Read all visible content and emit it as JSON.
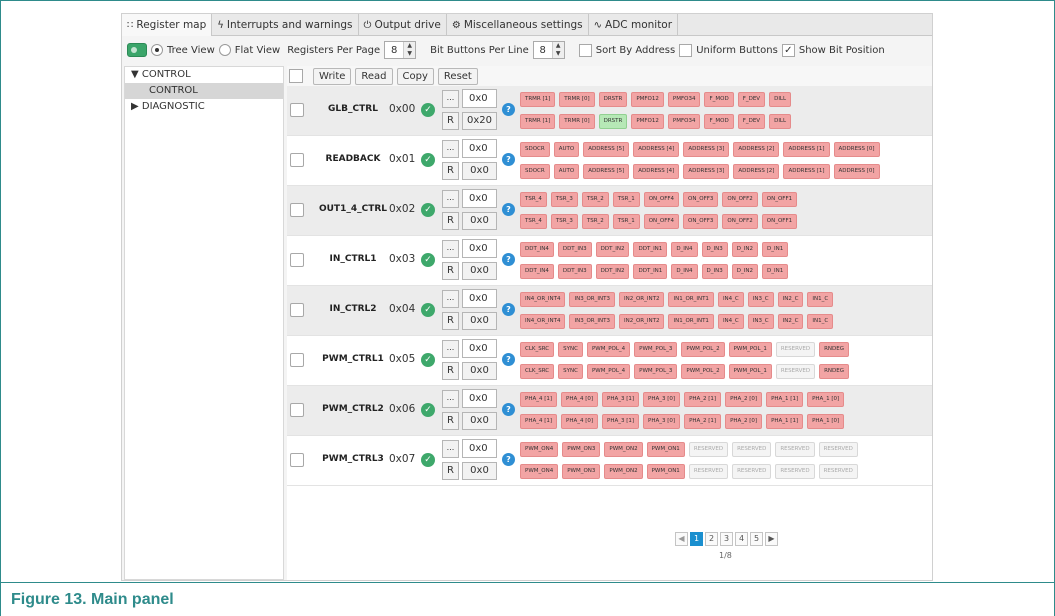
{
  "tabs": [
    {
      "label": "Register map",
      "icon": "grid-icon",
      "glyph": "∷"
    },
    {
      "label": "Interrupts and warnings",
      "icon": "lightning-icon",
      "glyph": "ϟ"
    },
    {
      "label": "Output drive",
      "icon": "power-icon",
      "glyph": "⏻"
    },
    {
      "label": "Miscellaneous settings",
      "icon": "gear-icon",
      "glyph": "⚙"
    },
    {
      "label": "ADC monitor",
      "icon": "oscilloscope-icon",
      "glyph": "∿"
    }
  ],
  "toolbar": {
    "tree_view": "Tree View",
    "flat_view": "Flat View",
    "registers_per_page_label": "Registers Per Page",
    "registers_per_page_value": "8",
    "bit_buttons_label": "Bit Buttons Per Line",
    "bit_buttons_value": "8",
    "sort_by_address": "Sort By Address",
    "uniform_buttons": "Uniform Buttons",
    "show_bit_position": "Show Bit Position"
  },
  "tree": {
    "items": [
      "▼ CONTROL",
      "CONTROL",
      "▶ DIAGNOSTIC"
    ]
  },
  "actions": {
    "write": "Write",
    "read": "Read",
    "copy": "Copy",
    "reset": "Reset"
  },
  "row_controls": {
    "dots": "...",
    "read": "R"
  },
  "registers": [
    {
      "name": "GLB_CTRL",
      "addr": "0x00",
      "write_value": "0x0",
      "read_value": "0x20",
      "bits_write": [
        "TRMR [1]",
        "TRMR [0]",
        "DRSTR",
        "PMFO12",
        "PMFO34",
        "F_MOD",
        "F_DEV",
        "DILL"
      ],
      "bits_read": [
        "TRMR [1]",
        "TRMR [0]",
        "DRSTR",
        "PMFO12",
        "PMFO34",
        "F_MOD",
        "F_DEV",
        "DILL"
      ]
    },
    {
      "name": "READBACK",
      "addr": "0x01",
      "write_value": "0x0",
      "read_value": "0x0",
      "bits_write": [
        "SDOCR",
        "AUTO",
        "ADDRESS [5]",
        "ADDRESS [4]",
        "ADDRESS [3]",
        "ADDRESS [2]",
        "ADDRESS [1]",
        "ADDRESS [0]"
      ],
      "bits_read": [
        "SDOCR",
        "AUTO",
        "ADDRESS [5]",
        "ADDRESS [4]",
        "ADDRESS [3]",
        "ADDRESS [2]",
        "ADDRESS [1]",
        "ADDRESS [0]"
      ]
    },
    {
      "name": "OUT1_4_CTRL",
      "addr": "0x02",
      "write_value": "0x0",
      "read_value": "0x0",
      "bits_write": [
        "TSR_4",
        "TSR_3",
        "TSR_2",
        "TSR_1",
        "ON_OFF4",
        "ON_OFF3",
        "ON_OFF2",
        "ON_OFF1"
      ],
      "bits_read": [
        "TSR_4",
        "TSR_3",
        "TSR_2",
        "TSR_1",
        "ON_OFF4",
        "ON_OFF3",
        "ON_OFF2",
        "ON_OFF1"
      ]
    },
    {
      "name": "IN_CTRL1",
      "addr": "0x03",
      "write_value": "0x0",
      "read_value": "0x0",
      "bits_write": [
        "DDT_IN4",
        "DDT_IN3",
        "DDT_IN2",
        "DDT_IN1",
        "D_IN4",
        "D_IN3",
        "D_IN2",
        "D_IN1"
      ],
      "bits_read": [
        "DDT_IN4",
        "DDT_IN3",
        "DDT_IN2",
        "DDT_IN1",
        "D_IN4",
        "D_IN3",
        "D_IN2",
        "D_IN1"
      ]
    },
    {
      "name": "IN_CTRL2",
      "addr": "0x04",
      "write_value": "0x0",
      "read_value": "0x0",
      "bits_write": [
        "IN4_OR_INT4",
        "IN3_OR_INT3",
        "IN2_OR_INT2",
        "IN1_OR_INT1",
        "IN4_C",
        "IN3_C",
        "IN2_C",
        "IN1_C"
      ],
      "bits_read": [
        "IN4_OR_INT4",
        "IN3_OR_INT3",
        "IN2_OR_INT2",
        "IN1_OR_INT1",
        "IN4_C",
        "IN3_C",
        "IN2_C",
        "IN1_C"
      ]
    },
    {
      "name": "PWM_CTRL1",
      "addr": "0x05",
      "write_value": "0x0",
      "read_value": "0x0",
      "bits_write": [
        "CLK_SRC",
        "SYNC",
        "PWM_POL_4",
        "PWM_POL_3",
        "PWM_POL_2",
        "PWM_POL_1",
        "RESERVED",
        "RNDEG"
      ],
      "bits_read": [
        "CLK_SRC",
        "SYNC",
        "PWM_POL_4",
        "PWM_POL_3",
        "PWM_POL_2",
        "PWM_POL_1",
        "RESERVED",
        "RNDEG"
      ]
    },
    {
      "name": "PWM_CTRL2",
      "addr": "0x06",
      "write_value": "0x0",
      "read_value": "0x0",
      "bits_write": [
        "PHA_4 [1]",
        "PHA_4 [0]",
        "PHA_3 [1]",
        "PHA_3 [0]",
        "PHA_2 [1]",
        "PHA_2 [0]",
        "PHA_1 [1]",
        "PHA_1 [0]"
      ],
      "bits_read": [
        "PHA_4 [1]",
        "PHA_4 [0]",
        "PHA_3 [1]",
        "PHA_3 [0]",
        "PHA_2 [1]",
        "PHA_2 [0]",
        "PHA_1 [1]",
        "PHA_1 [0]"
      ]
    },
    {
      "name": "PWM_CTRL3",
      "addr": "0x07",
      "write_value": "0x0",
      "read_value": "0x0",
      "bits_write": [
        "PWM_ON4",
        "PWM_ON3",
        "PWM_ON2",
        "PWM_ON1",
        "RESERVED",
        "RESERVED",
        "RESERVED",
        "RESERVED"
      ],
      "bits_read": [
        "PWM_ON4",
        "PWM_ON3",
        "PWM_ON2",
        "PWM_ON1",
        "RESERVED",
        "RESERVED",
        "RESERVED",
        "RESERVED"
      ]
    }
  ],
  "green_bit": {
    "register": 0,
    "row": "read",
    "index": 2
  },
  "pager": {
    "pages": [
      "1",
      "2",
      "3",
      "4",
      "5"
    ],
    "active": "1",
    "info": "1/8"
  },
  "caption": "Figure 13.  Main panel",
  "colors": {
    "bit": "#f2a4a4",
    "bit_set": "#b6e8b6",
    "ok": "#3ea86b",
    "help": "#2f8fd4",
    "caption": "#2e8b8b"
  }
}
